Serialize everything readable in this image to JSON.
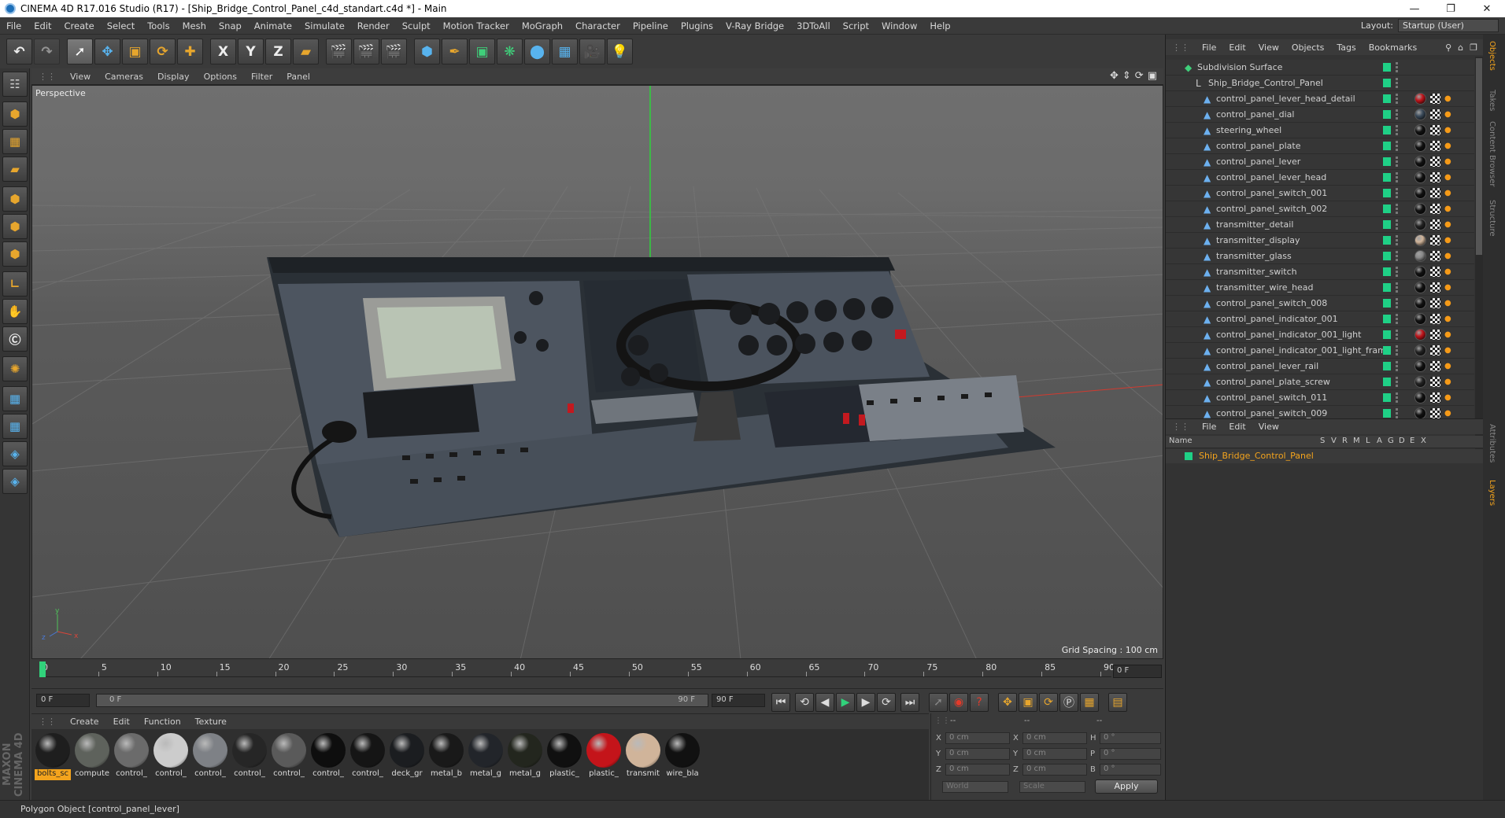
{
  "titlebar": {
    "title": "CINEMA 4D R17.016 Studio (R17) - [Ship_Bridge_Control_Panel_c4d_standart.c4d *] - Main"
  },
  "menubar": {
    "items": [
      "File",
      "Edit",
      "Create",
      "Select",
      "Tools",
      "Mesh",
      "Snap",
      "Animate",
      "Simulate",
      "Render",
      "Sculpt",
      "Motion Tracker",
      "MoGraph",
      "Character",
      "Pipeline",
      "Plugins",
      "V-Ray Bridge",
      "3DToAll",
      "Script",
      "Window",
      "Help"
    ],
    "layout_label": "Layout:",
    "layout_value": "Startup (User)"
  },
  "toolbar": {
    "axis_x": "X",
    "axis_y": "Y",
    "axis_z": "Z"
  },
  "viewport": {
    "menu": [
      "View",
      "Cameras",
      "Display",
      "Options",
      "Filter",
      "Panel"
    ],
    "label": "Perspective",
    "grid_spacing": "Grid Spacing : 100 cm"
  },
  "timeline": {
    "ticks": [
      0,
      5,
      10,
      15,
      20,
      25,
      30,
      35,
      40,
      45,
      50,
      55,
      60,
      65,
      70,
      75,
      80,
      85,
      90
    ],
    "current_frame": "0 F",
    "start_field": "0 F",
    "range_start": "0 F",
    "range_end": "90 F",
    "end_field": "90 F"
  },
  "materials": {
    "menu": [
      "Create",
      "Edit",
      "Function",
      "Texture"
    ],
    "items": [
      {
        "name": "bolts_sc",
        "color": "#1e1e1e",
        "selected": true
      },
      {
        "name": "compute",
        "color": "#5e625c"
      },
      {
        "name": "control_",
        "color": "#6b6b6b"
      },
      {
        "name": "control_",
        "color": "#cccccc"
      },
      {
        "name": "control_",
        "color": "#7e8186"
      },
      {
        "name": "control_",
        "color": "#262626"
      },
      {
        "name": "control_",
        "color": "#5a5a5a"
      },
      {
        "name": "control_",
        "color": "#0e0e0e"
      },
      {
        "name": "control_",
        "color": "#151515"
      },
      {
        "name": "deck_gr",
        "color": "#1b1d20"
      },
      {
        "name": "metal_b",
        "color": "#191919"
      },
      {
        "name": "metal_g",
        "color": "#22252a"
      },
      {
        "name": "metal_g",
        "color": "#23261e"
      },
      {
        "name": "plastic_",
        "color": "#101010"
      },
      {
        "name": "plastic_",
        "color": "#c4141a"
      },
      {
        "name": "transmit",
        "color": "#d0b49a"
      },
      {
        "name": "wire_bla",
        "color": "#111111"
      }
    ]
  },
  "coordinates": {
    "header_a": "--",
    "header_b": "--",
    "header_c": "--",
    "rows": [
      {
        "a": "X",
        "av": "0 cm",
        "b": "X",
        "bv": "0 cm",
        "c": "H",
        "cv": "0 °"
      },
      {
        "a": "Y",
        "av": "0 cm",
        "b": "Y",
        "bv": "0 cm",
        "c": "P",
        "cv": "0 °"
      },
      {
        "a": "Z",
        "av": "0 cm",
        "b": "Z",
        "bv": "0 cm",
        "c": "B",
        "cv": "0 °"
      }
    ],
    "mode1": "World",
    "mode2": "Scale",
    "apply": "Apply"
  },
  "objects": {
    "menu": [
      "File",
      "Edit",
      "View",
      "Objects",
      "Tags",
      "Bookmarks"
    ],
    "root": "Subdivision Surface",
    "group": "Ship_Bridge_Control_Panel",
    "children": [
      {
        "name": "control_panel_lever_head_detail",
        "tag": "#c0141a"
      },
      {
        "name": "control_panel_dial",
        "tag": "#3a4a5a"
      },
      {
        "name": "steering_wheel",
        "tag": "#111"
      },
      {
        "name": "control_panel_plate",
        "tag": "#111"
      },
      {
        "name": "control_panel_lever",
        "tag": "#111"
      },
      {
        "name": "control_panel_lever_head",
        "tag": "#111"
      },
      {
        "name": "control_panel_switch_001",
        "tag": "#111"
      },
      {
        "name": "control_panel_switch_002",
        "tag": "#111"
      },
      {
        "name": "transmitter_detail",
        "tag": "#222"
      },
      {
        "name": "transmitter_display",
        "tag": "#d0b49a"
      },
      {
        "name": "transmitter_glass",
        "tag": "#888"
      },
      {
        "name": "transmitter_switch",
        "tag": "#111"
      },
      {
        "name": "transmitter_wire_head",
        "tag": "#111"
      },
      {
        "name": "control_panel_switch_008",
        "tag": "#111"
      },
      {
        "name": "control_panel_indicator_001",
        "tag": "#111"
      },
      {
        "name": "control_panel_indicator_001_light",
        "tag": "#c0141a"
      },
      {
        "name": "control_panel_indicator_001_light_frame",
        "tag": "#222"
      },
      {
        "name": "control_panel_lever_rail",
        "tag": "#111"
      },
      {
        "name": "control_panel_plate_screw",
        "tag": "#222"
      },
      {
        "name": "control_panel_switch_011",
        "tag": "#111"
      },
      {
        "name": "control_panel_switch_009",
        "tag": "#111"
      }
    ]
  },
  "layers": {
    "menu": [
      "File",
      "Edit",
      "View"
    ],
    "headers": [
      "Name",
      "S",
      "V",
      "R",
      "M",
      "L",
      "A",
      "G",
      "D",
      "E",
      "X"
    ],
    "row": "Ship_Bridge_Control_Panel"
  },
  "sidetabs": [
    "Objects",
    "Takes",
    "Content Browser",
    "Structure",
    "Attributes",
    "Layers"
  ],
  "status": {
    "text": "Polygon Object [control_panel_lever]"
  }
}
